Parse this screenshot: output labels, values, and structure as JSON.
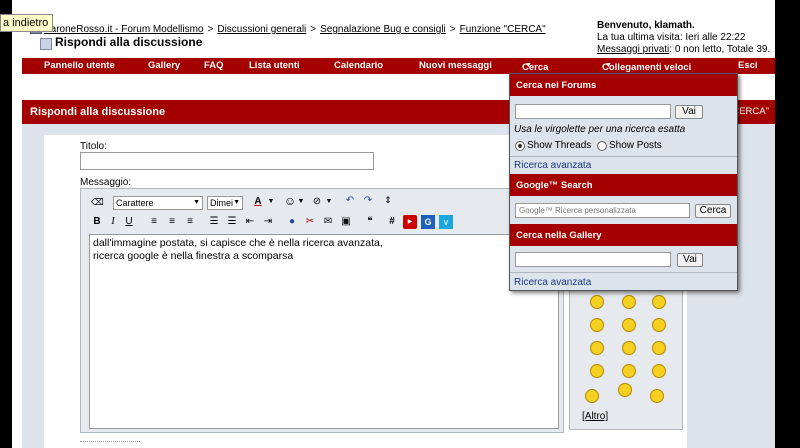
{
  "tooltip": {
    "text": "a indietro"
  },
  "breadcrumb": {
    "items": [
      "BaroneRosso.it - Forum Modellismo",
      "Discussioni generali",
      "Segnalazione Bug e consigli",
      "Funzione \"CERCA\""
    ],
    "separator": ">"
  },
  "page_title": "Rispondi alla discussione",
  "welcome": {
    "greeting": "Benvenuto, klamath.",
    "last_visit": "La tua ultima visita: Ieri alle 22:22",
    "pm_link": "Messaggi privati",
    "pm_status": ": 0 non letto, Totale 39."
  },
  "navbar": {
    "items": [
      "Pannello utente",
      "Gallery",
      "FAQ",
      "Lista utenti",
      "Calendario",
      "Nuovi messaggi",
      "Cerca",
      "Collegamenti veloci",
      "Esci"
    ],
    "arrow": "▼"
  },
  "panel": {
    "title": "Rispondi alla discussione",
    "right_fragment": "CERCA\""
  },
  "form": {
    "title_label": "Titolo:",
    "title_value": "",
    "message_label": "Messaggio:"
  },
  "editor": {
    "font_select": "Carattere",
    "size_select": "Dimei",
    "message_lines": [
      "dall'immagine postata, si capisce che è nella ricerca avanzata,",
      "ricerca google è nella finestra a scomparsa"
    ]
  },
  "smilies": {
    "more_link": "[Altro]"
  },
  "search_dropdown": {
    "forums": {
      "header": "Cerca nei Forums",
      "input_value": "",
      "button": "Vai",
      "note": "Usa le virgolette per una ricerca esatta",
      "radio_threads": "Show Threads",
      "radio_posts": "Show Posts",
      "selected": "threads",
      "advanced_link": "Ricerca avanzata"
    },
    "google": {
      "header": "Google™ Search",
      "placeholder": "Google™ Ricerca personalizzata",
      "button": "Cerca"
    },
    "gallery": {
      "header": "Cerca nella Gallery",
      "input_value": "",
      "button": "Vai",
      "advanced_link": "Ricerca avanzata"
    }
  },
  "colors": {
    "accent": "#a50000",
    "panel_bg": "#dde3ea"
  }
}
